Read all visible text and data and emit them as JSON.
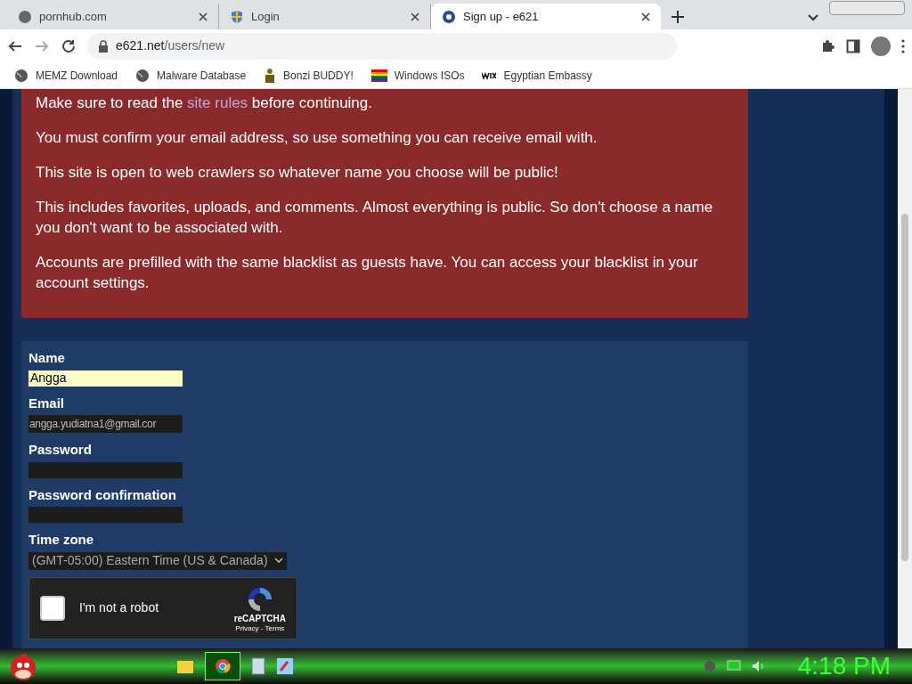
{
  "browser": {
    "tabs": [
      {
        "title": "pornhub.com",
        "selected": false
      },
      {
        "title": "Login",
        "selected": false
      },
      {
        "title": "Sign up - e621",
        "selected": true
      }
    ],
    "url_host": "e621.net",
    "url_path": "/users/new",
    "bookmarks": [
      {
        "label": "MEMZ Download",
        "kind": "globe"
      },
      {
        "label": "Malware Database",
        "kind": "globe"
      },
      {
        "label": "Bonzi BUDDY!",
        "kind": "figure"
      },
      {
        "label": "Windows ISOs",
        "kind": "rainbow"
      },
      {
        "label": "Egyptian Embassy",
        "kind": "wix"
      }
    ]
  },
  "notice": [
    "Make sure to read the **site rules** before continuing.",
    "You must confirm your email address, so use something you can receive email with.",
    "This site is open to web crawlers so whatever name you choose will be public!",
    "This includes favorites, uploads, and comments. Almost everything is public. So don't choose a name you don't want to be associated with.",
    "Accounts are prefilled with the same blacklist as guests have. You can access your blacklist in your account settings."
  ],
  "form": {
    "fields": [
      {
        "label": "Name",
        "value": "Angga",
        "kind": "autofill"
      },
      {
        "label": "Email",
        "value": "angga.yudiatna1@gmail.cor",
        "kind": "text"
      },
      {
        "label": "Password",
        "kind": "password"
      },
      {
        "label": "Password confirmation",
        "kind": "password"
      },
      {
        "label": "Time zone",
        "value": "(GMT-05:00) Eastern Time (US & Canada)",
        "kind": "select"
      }
    ],
    "captcha": {
      "label": "I'm not a robot",
      "checked": false,
      "brand": "reCAPTCHA",
      "links": "Privacy - Terms"
    }
  },
  "taskbar": {
    "clock": "4:18 PM"
  }
}
